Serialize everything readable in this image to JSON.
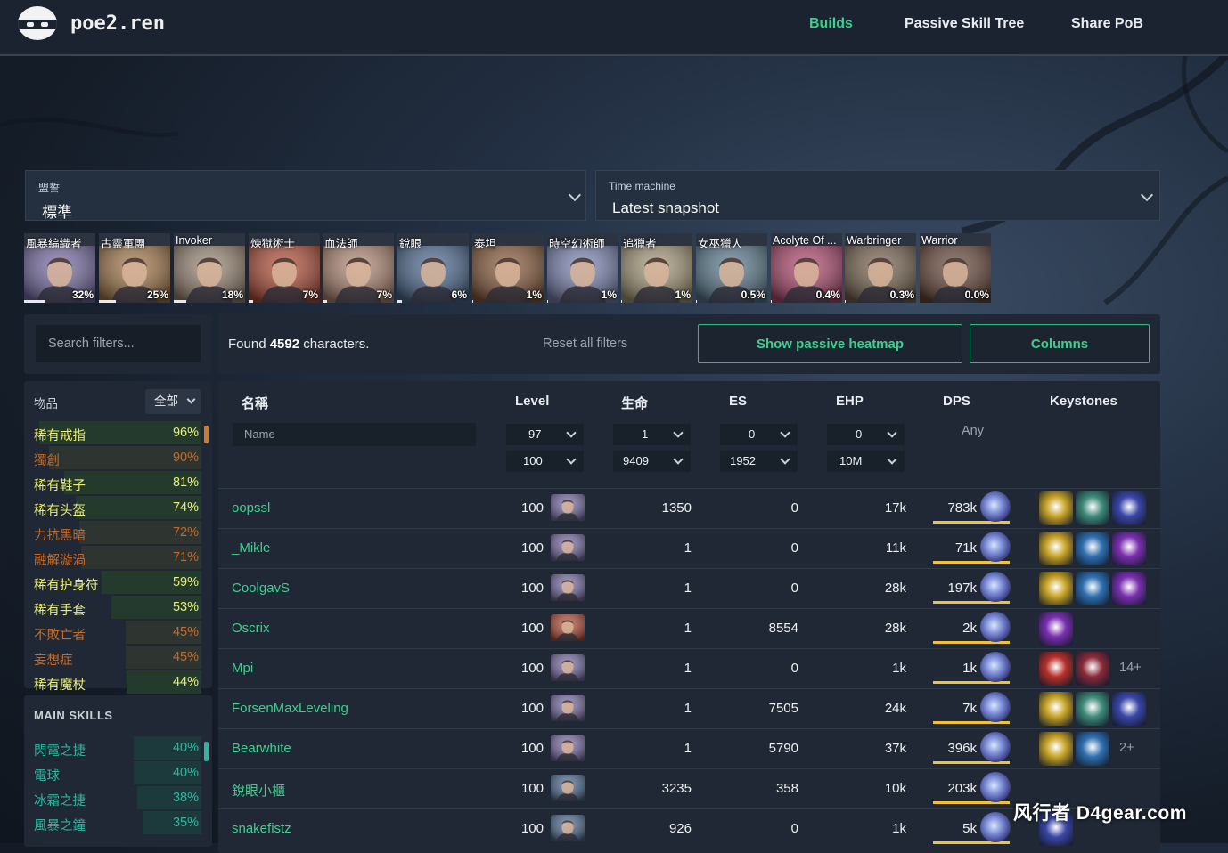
{
  "nav": {
    "brand": "poe2.ren",
    "links": [
      {
        "label": "Builds",
        "active": true
      },
      {
        "label": "Passive Skill Tree",
        "active": false
      },
      {
        "label": "Share PoB",
        "active": false
      }
    ]
  },
  "league": {
    "label": "盟誓",
    "value": "標準"
  },
  "time_machine": {
    "label": "Time machine",
    "value": "Latest snapshot"
  },
  "classes": [
    {
      "name": "風暴編織者",
      "pct": "32%",
      "share": 0.32,
      "color": "#7a6fa8"
    },
    {
      "name": "古靈軍團",
      "pct": "25%",
      "share": 0.25,
      "color": "#a5794c"
    },
    {
      "name": "Invoker",
      "pct": "18%",
      "share": 0.18,
      "color": "#9b8775"
    },
    {
      "name": "煉獄術士",
      "pct": "7%",
      "share": 0.07,
      "color": "#b4503a"
    },
    {
      "name": "血法師",
      "pct": "7%",
      "share": 0.07,
      "color": "#b48a76"
    },
    {
      "name": "銳眼",
      "pct": "6%",
      "share": 0.06,
      "color": "#4f6c93"
    },
    {
      "name": "泰坦",
      "pct": "1%",
      "share": 0.01,
      "color": "#8a5c3c"
    },
    {
      "name": "時空幻術師",
      "pct": "1%",
      "share": 0.01,
      "color": "#7d86b5"
    },
    {
      "name": "追獵者",
      "pct": "1%",
      "share": 0.01,
      "color": "#a79a7a"
    },
    {
      "name": "女巫獵人",
      "pct": "0.5%",
      "share": 0.005,
      "color": "#5b7c90"
    },
    {
      "name": "Acolyte Of ...",
      "pct": "0.4%",
      "share": 0.004,
      "color": "#b24b70"
    },
    {
      "name": "Warbringer",
      "pct": "0.3%",
      "share": 0.003,
      "color": "#7a6652"
    },
    {
      "name": "Warrior",
      "pct": "0.0%",
      "share": 0.0,
      "color": "#6a4a3c"
    }
  ],
  "filters": {
    "search_placeholder": "Search filters...",
    "found_prefix": "Found",
    "found_count": "4592",
    "found_suffix": "characters.",
    "reset_label": "Reset all filters",
    "heatmap_label": "Show passive heatmap",
    "columns_label": "Columns"
  },
  "items_facet": {
    "title": "物品",
    "dropdown": "全部",
    "rows": [
      {
        "label": "稀有戒指",
        "pct": "96%",
        "share": 0.96,
        "kind": "green"
      },
      {
        "label": "獨創",
        "pct": "90%",
        "share": 0.9,
        "kind": "orange"
      },
      {
        "label": "稀有鞋子",
        "pct": "81%",
        "share": 0.81,
        "kind": "green"
      },
      {
        "label": "稀有头盔",
        "pct": "74%",
        "share": 0.74,
        "kind": "green"
      },
      {
        "label": "力抗黑暗",
        "pct": "72%",
        "share": 0.72,
        "kind": "orange"
      },
      {
        "label": "融解漩渦",
        "pct": "71%",
        "share": 0.71,
        "kind": "orange"
      },
      {
        "label": "稀有护身符",
        "pct": "59%",
        "share": 0.59,
        "kind": "green"
      },
      {
        "label": "稀有手套",
        "pct": "53%",
        "share": 0.53,
        "kind": "green"
      },
      {
        "label": "不敗亡者",
        "pct": "45%",
        "share": 0.45,
        "kind": "orange"
      },
      {
        "label": "妄想症",
        "pct": "45%",
        "share": 0.45,
        "kind": "orange"
      },
      {
        "label": "稀有魔杖",
        "pct": "44%",
        "share": 0.44,
        "kind": "green"
      }
    ]
  },
  "skills_facet": {
    "title": "MAIN SKILLS",
    "rows": [
      {
        "label": "閃電之捷",
        "pct": "40%",
        "share": 0.4
      },
      {
        "label": "電球",
        "pct": "40%",
        "share": 0.4
      },
      {
        "label": "冰霜之捷",
        "pct": "38%",
        "share": 0.38
      },
      {
        "label": "風暴之鐘",
        "pct": "35%",
        "share": 0.35
      }
    ]
  },
  "table": {
    "headers": {
      "name": "名稱",
      "level": "Level",
      "life": "生命",
      "es": "ES",
      "ehp": "EHP",
      "dps": "DPS",
      "keystones": "Keystones"
    },
    "name_placeholder": "Name",
    "level_range": [
      "97",
      "100"
    ],
    "life_range": [
      "1",
      "9409"
    ],
    "es_range": [
      "0",
      "1952"
    ],
    "ehp_range": [
      "0",
      "10M"
    ],
    "dps_filter": "Any",
    "rows": [
      {
        "name": "oopssl",
        "level": "100",
        "life": "1350",
        "es": "0",
        "ehp": "17k",
        "dps": "783k",
        "dps_share": 0.95,
        "cls": 0,
        "keystones": [
          "#c8a326",
          "#3f8a7a",
          "#3b46a8"
        ],
        "more": ""
      },
      {
        "name": "_Mikle",
        "level": "100",
        "life": "1",
        "es": "0",
        "ehp": "11k",
        "dps": "71k",
        "dps_share": 0.95,
        "cls": 0,
        "keystones": [
          "#c8a326",
          "#2f6fb0",
          "#7b2fb0"
        ],
        "more": ""
      },
      {
        "name": "CoolgavS",
        "level": "100",
        "life": "1",
        "es": "0",
        "ehp": "28k",
        "dps": "197k",
        "dps_share": 0.95,
        "cls": 0,
        "keystones": [
          "#c8a326",
          "#2f6fb0",
          "#7b2fb0"
        ],
        "more": ""
      },
      {
        "name": "Oscrix",
        "level": "100",
        "life": "1",
        "es": "8554",
        "ehp": "28k",
        "dps": "2k",
        "dps_share": 0.95,
        "cls": 3,
        "keystones": [
          "#7b2fb0"
        ],
        "more": ""
      },
      {
        "name": "Mpi",
        "level": "100",
        "life": "1",
        "es": "0",
        "ehp": "1k",
        "dps": "1k",
        "dps_share": 0.95,
        "cls": 0,
        "keystones": [
          "#b8302a",
          "#8a2a3a"
        ],
        "more": "14+"
      },
      {
        "name": "ForsenMaxLeveling",
        "level": "100",
        "life": "1",
        "es": "7505",
        "ehp": "24k",
        "dps": "7k",
        "dps_share": 0.95,
        "cls": 0,
        "keystones": [
          "#c8a326",
          "#3f8a7a",
          "#3b46a8"
        ],
        "more": ""
      },
      {
        "name": "Bearwhite",
        "level": "100",
        "life": "1",
        "es": "5790",
        "ehp": "37k",
        "dps": "396k",
        "dps_share": 0.95,
        "cls": 0,
        "keystones": [
          "#c8a326",
          "#2f6fb0"
        ],
        "more": "2+"
      },
      {
        "name": "銳眼小櫃",
        "level": "100",
        "life": "3235",
        "es": "358",
        "ehp": "10k",
        "dps": "203k",
        "dps_share": 0.95,
        "cls": 5,
        "keystones": [],
        "more": ""
      },
      {
        "name": "snakefistz",
        "level": "100",
        "life": "926",
        "es": "0",
        "ehp": "1k",
        "dps": "5k",
        "dps_share": 0.95,
        "cls": 5,
        "keystones": [
          "#3b46a8"
        ],
        "more": ""
      }
    ]
  },
  "watermark": "风行者 D4gear.com"
}
